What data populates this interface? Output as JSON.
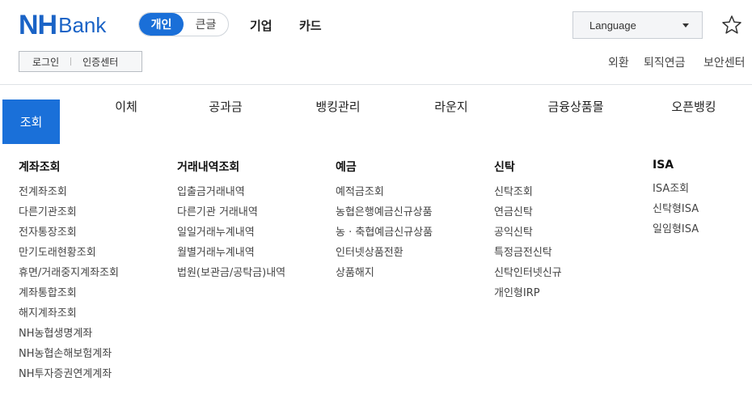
{
  "logo": {
    "nh": "NH",
    "bank": "Bank"
  },
  "mode_toggle": {
    "personal": "개인",
    "large": "큰글"
  },
  "top_links": {
    "corporate": "기업",
    "card": "카드"
  },
  "language": {
    "label": "Language"
  },
  "auth": {
    "login": "로그인",
    "cert": "인증센터"
  },
  "util_links": {
    "fx": "외환",
    "pension": "퇴직연금",
    "security": "보안센터"
  },
  "nav": {
    "active": "조회",
    "items": [
      "이체",
      "공과금",
      "뱅킹관리",
      "라운지",
      "금융상품몰",
      "오픈뱅킹"
    ]
  },
  "menu": {
    "account": {
      "title": "계좌조회",
      "items": [
        "전계좌조회",
        "다른기관조회",
        "전자통장조회",
        "만기도래현황조회",
        "휴면/거래중지계좌조회",
        "계좌통합조회",
        "해지계좌조회",
        "NH농협생명계좌",
        "NH농협손해보험계좌",
        "NH투자증권연계계좌"
      ]
    },
    "transactions": {
      "title": "거래내역조회",
      "items": [
        "입출금거래내역",
        "다른기관 거래내역",
        "일일거래누계내역",
        "월별거래누계내역",
        "법원(보관금/공탁금)내역"
      ]
    },
    "deposit": {
      "title": "예금",
      "items": [
        "예적금조회",
        "농협은행예금신규상품",
        "농 · 축협예금신규상품",
        "인터넷상품전환",
        "상품해지"
      ]
    },
    "trust": {
      "title": "신탁",
      "items": [
        "신탁조회",
        "연금신탁",
        "공익신탁",
        "특정금전신탁",
        "신탁인터넷신규",
        "개인형IRP"
      ]
    },
    "isa": {
      "title": "ISA",
      "items": [
        "ISA조회",
        "신탁형ISA",
        "일임형ISA"
      ]
    }
  },
  "colors": {
    "brand": "#1a63c6",
    "active_nav": "#1a70d9"
  },
  "icons": {
    "star": "star-icon",
    "caret": "chevron-down-icon"
  }
}
